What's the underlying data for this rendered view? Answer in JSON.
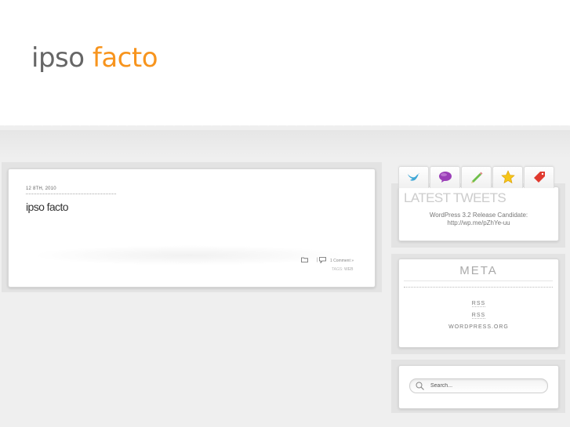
{
  "site": {
    "title_part1": "ipso",
    "title_part2": "facto",
    "title_part1_color": "#666666",
    "title_part2_color": "#f7941d"
  },
  "post": {
    "date": "12 8TH, 2010",
    "title": "ipso facto",
    "pipe": "|",
    "comments": "1 Comment »",
    "tags_label": "TAGS:",
    "tags": "WEB"
  },
  "sidebar": {
    "tabs": [
      {
        "icon": "bird-icon"
      },
      {
        "icon": "speech-bubble-icon"
      },
      {
        "icon": "pencil-icon"
      },
      {
        "icon": "star-icon"
      },
      {
        "icon": "tag-icon"
      }
    ],
    "tweets": {
      "title": "LATEST TWEETS",
      "text_line1": "WordPress 3.2 Release Candidate:",
      "text_line2": "http://wp.me/pZhYe-uu"
    },
    "meta": {
      "title": "META",
      "items": [
        "RSS",
        "RSS",
        "WORDPRESS.ORG"
      ]
    },
    "search": {
      "placeholder": "Search..."
    }
  }
}
